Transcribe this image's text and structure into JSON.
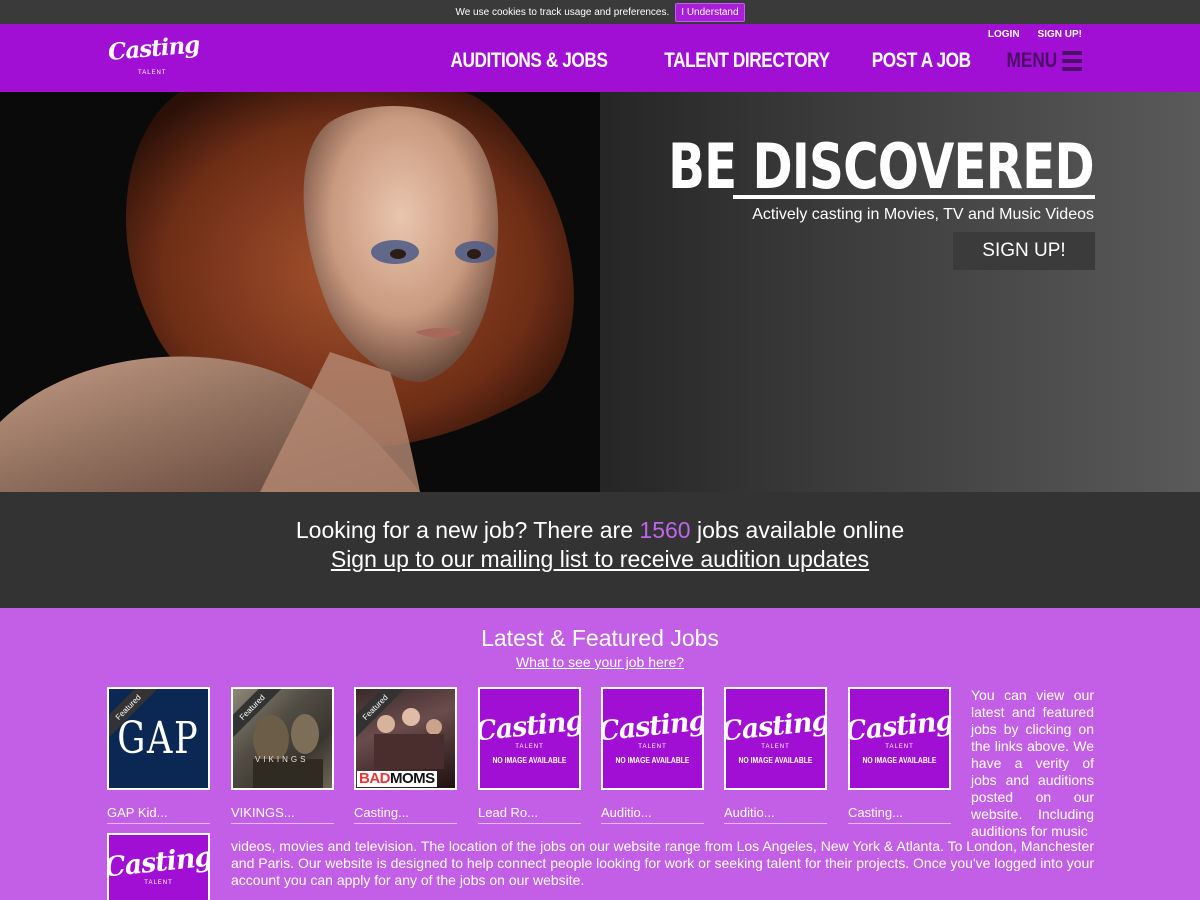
{
  "cookie": {
    "message": "We use cookies to track usage and preferences.",
    "button": "I Understand"
  },
  "header": {
    "logo_text": "Casting",
    "logo_sub": "TALENT",
    "login": "LOGIN",
    "signup": "SIGN UP!",
    "nav": [
      "AUDITIONS & JOBS",
      "TALENT DIRECTORY",
      "POST A JOB"
    ],
    "menu": "MENU"
  },
  "hero": {
    "title": "BE DISCOVERED",
    "subtitle": "Actively casting in Movies, TV and Music Videos",
    "cta": "SIGN UP!"
  },
  "info": {
    "line1_prefix": "Looking for a new job? There are ",
    "job_count": "1560",
    "line1_suffix": " jobs available online",
    "line2": "Sign up to our mailing list to receive audition updates"
  },
  "jobs": {
    "title": "Latest & Featured Jobs",
    "link": "What to see your job here?",
    "featured_label": "Featured",
    "placeholder_script": "Casting",
    "placeholder_talent": "TALENT",
    "placeholder_noimg": "NO IMAGE AVAILABLE",
    "gap_logo": "GAP",
    "vikings_logo": "VIKINGS",
    "badmoms_logo_1": "BAD",
    "badmoms_logo_2": "MOMS",
    "cards": [
      {
        "caption": "GAP Kid..."
      },
      {
        "caption": "VIKINGS..."
      },
      {
        "caption": "Casting..."
      },
      {
        "caption": "Lead Ro..."
      },
      {
        "caption": "Auditio..."
      },
      {
        "caption": "Auditio..."
      },
      {
        "caption": "Casting..."
      }
    ],
    "about_right": "You can view our latest and featured jobs by clicking on the links above. We have a verity of jobs and auditions posted on our website. Including auditions for music",
    "about_bottom": "videos, movies and television. The location of the jobs on our website range from Los Angeles, New York & Atlanta. To London, Manchester and Paris. Our website is designed to help connect people looking for work or seeking talent for their projects. Once you've logged into your account you can apply for any of the jobs on our website."
  },
  "colors": {
    "header_purple": "#a10fd4",
    "page_purple": "#c35fe6",
    "dark_band": "#333333",
    "count_accent": "#c065ec"
  }
}
